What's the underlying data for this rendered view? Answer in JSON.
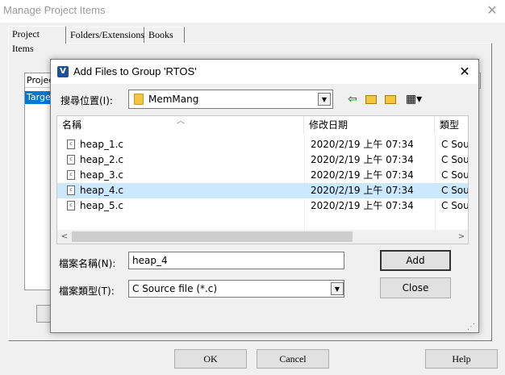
{
  "bg_window": {
    "title": "Manage Project Items",
    "tabs": [
      "Project Items",
      "Folders/Extensions",
      "Books"
    ],
    "list_header": "Projec",
    "list_item": "Target",
    "buttons": {
      "ok": "OK",
      "cancel": "Cancel",
      "help": "Help"
    }
  },
  "dialog": {
    "title": "Add Files to Group 'RTOS'",
    "look_in_label": "搜尋位置(I):",
    "look_in_value": "MemMang",
    "columns": {
      "name": "名稱",
      "date": "修改日期",
      "type": "類型"
    },
    "files": [
      {
        "name": "heap_1.c",
        "date": "2020/2/19 上午 07:34",
        "type": "C Sour"
      },
      {
        "name": "heap_2.c",
        "date": "2020/2/19 上午 07:34",
        "type": "C Sour"
      },
      {
        "name": "heap_3.c",
        "date": "2020/2/19 上午 07:34",
        "type": "C Sour"
      },
      {
        "name": "heap_4.c",
        "date": "2020/2/19 上午 07:34",
        "type": "C Sour"
      },
      {
        "name": "heap_5.c",
        "date": "2020/2/19 上午 07:34",
        "type": "C Sour"
      }
    ],
    "selected_file": "heap_4.c",
    "filename_label": "檔案名稱(N):",
    "filename_value": "heap_4",
    "filetype_label": "檔案類型(T):",
    "filetype_value": "C Source file (*.c)",
    "add_label": "Add",
    "close_label": "Close"
  },
  "colors": {
    "selection": "#cce8ff",
    "folder": "#f5c542",
    "bg_selection": "#0078d7"
  },
  "icons": [
    "close-icon",
    "app-icon",
    "folder-icon",
    "back-icon",
    "up-folder-icon",
    "new-folder-icon",
    "view-menu-icon",
    "file-icon",
    "sort-arrow-icon"
  ]
}
